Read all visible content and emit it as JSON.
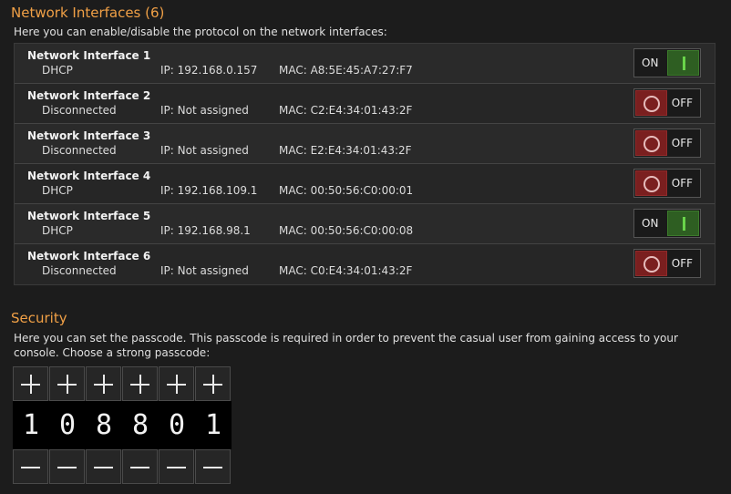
{
  "network": {
    "title": "Network Interfaces (6)",
    "description": "Here you can enable/disable the protocol on the network interfaces:",
    "interfaces": [
      {
        "name": "Network Interface 1",
        "status": "DHCP",
        "ip": "IP: 192.168.0.157",
        "mac": "MAC: A8:5E:45:A7:27:F7",
        "state": "ON"
      },
      {
        "name": "Network Interface 2",
        "status": "Disconnected",
        "ip": "IP: Not assigned",
        "mac": "MAC: C2:E4:34:01:43:2F",
        "state": "OFF"
      },
      {
        "name": "Network Interface 3",
        "status": "Disconnected",
        "ip": "IP: Not assigned",
        "mac": "MAC: E2:E4:34:01:43:2F",
        "state": "OFF"
      },
      {
        "name": "Network Interface 4",
        "status": "DHCP",
        "ip": "IP: 192.168.109.1",
        "mac": "MAC: 00:50:56:C0:00:01",
        "state": "OFF"
      },
      {
        "name": "Network Interface 5",
        "status": "DHCP",
        "ip": "IP: 192.168.98.1",
        "mac": "MAC: 00:50:56:C0:00:08",
        "state": "ON"
      },
      {
        "name": "Network Interface 6",
        "status": "Disconnected",
        "ip": "IP: Not assigned",
        "mac": "MAC: C0:E4:34:01:43:2F",
        "state": "OFF"
      }
    ]
  },
  "security": {
    "title": "Security",
    "description": "Here you can set the passcode. This passcode is required in order to prevent the casual user from gaining access to your console. Choose a strong passcode:",
    "passcode": [
      "1",
      "0",
      "8",
      "8",
      "0",
      "1"
    ]
  },
  "colors": {
    "accent": "#f0a046",
    "on": "#2e5e22",
    "off": "#7a1f1f",
    "background": "#1c1c1c"
  },
  "icons": {
    "on_knob": "power-on-bar-icon",
    "off_knob": "power-off-ring-icon",
    "increment": "plus-icon",
    "decrement": "minus-icon"
  }
}
